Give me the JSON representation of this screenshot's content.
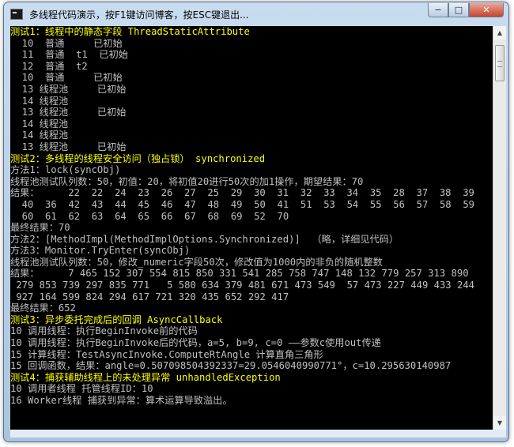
{
  "window": {
    "title": "多线程代码演示，按F1键访问博客，按ESC键退出...",
    "buttons": {
      "minimize": "−",
      "maximize": "□",
      "close": "✕"
    },
    "icon": "console-app-icon"
  },
  "scrollbar": {
    "up_arrow": "▲",
    "down_arrow": "▼"
  },
  "colors": {
    "console_bg": "#000000",
    "text": "#c0c0c0",
    "heading": "#ffff00"
  },
  "console": {
    "lines": [
      {
        "text": "测试1：线程中的静态字段 ThreadStaticAttribute",
        "color": "yellow"
      },
      {
        "text": "  10  普通     已初始",
        "color": "white"
      },
      {
        "text": "  11  普通  t1  已初始",
        "color": "white"
      },
      {
        "text": "  12  普通  t2",
        "color": "white"
      },
      {
        "text": "  10  普通     已初始",
        "color": "white"
      },
      {
        "text": "  13 线程池     已初始",
        "color": "white"
      },
      {
        "text": "  14 线程池",
        "color": "white"
      },
      {
        "text": "  13 线程池     已初始",
        "color": "white"
      },
      {
        "text": "  14 线程池",
        "color": "white"
      },
      {
        "text": "  14 线程池",
        "color": "white"
      },
      {
        "text": "  13 线程池     已初始",
        "color": "white"
      },
      {
        "text": "测试2：多线程的线程安全访问（独占锁） synchronized",
        "color": "yellow"
      },
      {
        "text": "方法1：lock(syncObj)",
        "color": "white"
      },
      {
        "text": "线程池测试队列数：50，初值：20，将初值20进行50次的加1操作，期望结果：70",
        "color": "white"
      },
      {
        "text": "结果：     22  22  24  23  26  27  25  29  30  31  32  33  34  35  28  37  38  39",
        "color": "white"
      },
      {
        "text": "  40  36  42  43  44  45  46  47  48  49  50  41  51  53  54  55  56  57  58  59",
        "color": "white"
      },
      {
        "text": "  60  61  62  63  64  65  66  67  68  69  52  70",
        "color": "white"
      },
      {
        "text": "最终结果：70",
        "color": "white"
      },
      {
        "text": "方法2：[MethodImpl(MethodImplOptions.Synchronized)]  （略，详细见代码）",
        "color": "white"
      },
      {
        "text": "方法3：Monitor.TryEnter(syncObj)",
        "color": "white"
      },
      {
        "text": "线程池测试队列数：50，修改_numeric字段50次，修改值为1000内的非负的随机整数",
        "color": "white"
      },
      {
        "text": "结果：     7 465 152 307 554 815 850 331 541 285 758 747 148 132 779 257 313 890",
        "color": "white"
      },
      {
        "text": " 279 853 739 297 835 771   5 580 634 379 481 671 473 549  57 473 227 449 433 244",
        "color": "white"
      },
      {
        "text": " 927 164 599 824 294 617 721 320 435 652 292 417",
        "color": "white"
      },
      {
        "text": "最终结果：652",
        "color": "white"
      },
      {
        "text": "测试3：异步委托完成后的回调 AsyncCallback",
        "color": "yellow"
      },
      {
        "text": "10 调用线程：执行BeginInvoke前的代码",
        "color": "white"
      },
      {
        "text": "10 调用线程：执行BeginInvoke后的代码，a=5, b=9, c=0 ——参数c使用out传递",
        "color": "white"
      },
      {
        "text": "15 计算线程：TestAsyncInvoke.ComputeRtAngle 计算直角三角形",
        "color": "white"
      },
      {
        "text": "15 回调函数，结果：angle=0.507098504392337=29.0546040990771°，c=10.295630140987",
        "color": "white"
      },
      {
        "text": "测试4：捕获辅助线程上的未处理异常 unhandledException",
        "color": "yellow"
      },
      {
        "text": "10 调用者线程 托管线程ID：10",
        "color": "white"
      },
      {
        "text": "16 Worker线程 捕获到异常：算术运算导致溢出。",
        "color": "white"
      }
    ]
  }
}
